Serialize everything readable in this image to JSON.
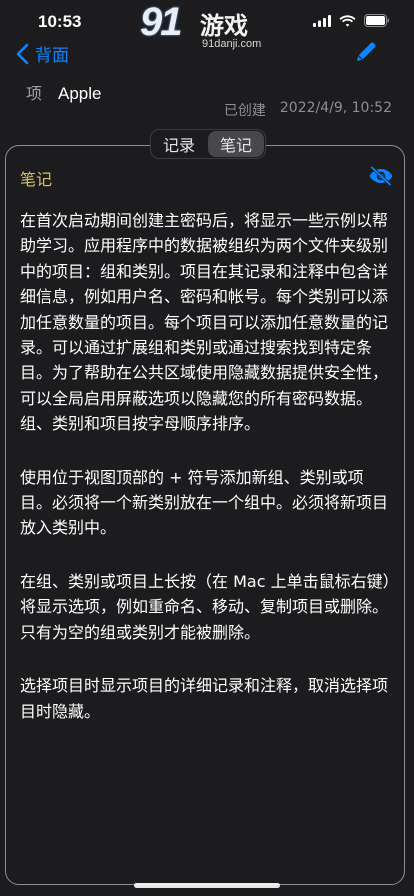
{
  "status_bar": {
    "time": "10:53"
  },
  "watermark": {
    "logo": "91",
    "brand": "游戏",
    "url": "91danji.com"
  },
  "nav": {
    "back_label": "背面"
  },
  "item": {
    "label": "项",
    "value": "Apple"
  },
  "created": {
    "label": "已创建",
    "value": "2022/4/9, 10:52"
  },
  "segmented": {
    "items": [
      "记录",
      "笔记"
    ],
    "selected": "笔记"
  },
  "note": {
    "title": "笔记",
    "paragraphs": [
      "在首次启动期间创建主密码后，将显示一些示例以帮助学习。应用程序中的数据被组织为两个文件夹级别中的项目：组和类别。项目在其记录和注释中包含详细信息，例如用户名、密码和帐号。每个类别可以添加任意数量的项目。每个项目可以添加任意数量的记录。可以通过扩展组和类别或通过搜索找到特定条目。为了帮助在公共区域使用隐藏数据提供安全性，可以全局启用屏蔽选项以隐藏您的所有密码数据。组、类别和项目按字母顺序排序。",
      "使用位于视图顶部的 + 符号添加新组、类别或项目。必须将一个新类别放在一个组中。必须将新项目放入类别中。",
      "在组、类别或项目上长按（在 Mac 上单击鼠标右键）将显示选项，例如重命名、移动、复制项目或删除。只有为空的组或类别才能被删除。",
      "选择项目时显示项目的详细记录和注释，取消选择项目时隐藏。"
    ]
  },
  "colors": {
    "accent": "#0a84ff",
    "note_title": "#d4c36a",
    "background": "#1c1c1e"
  }
}
